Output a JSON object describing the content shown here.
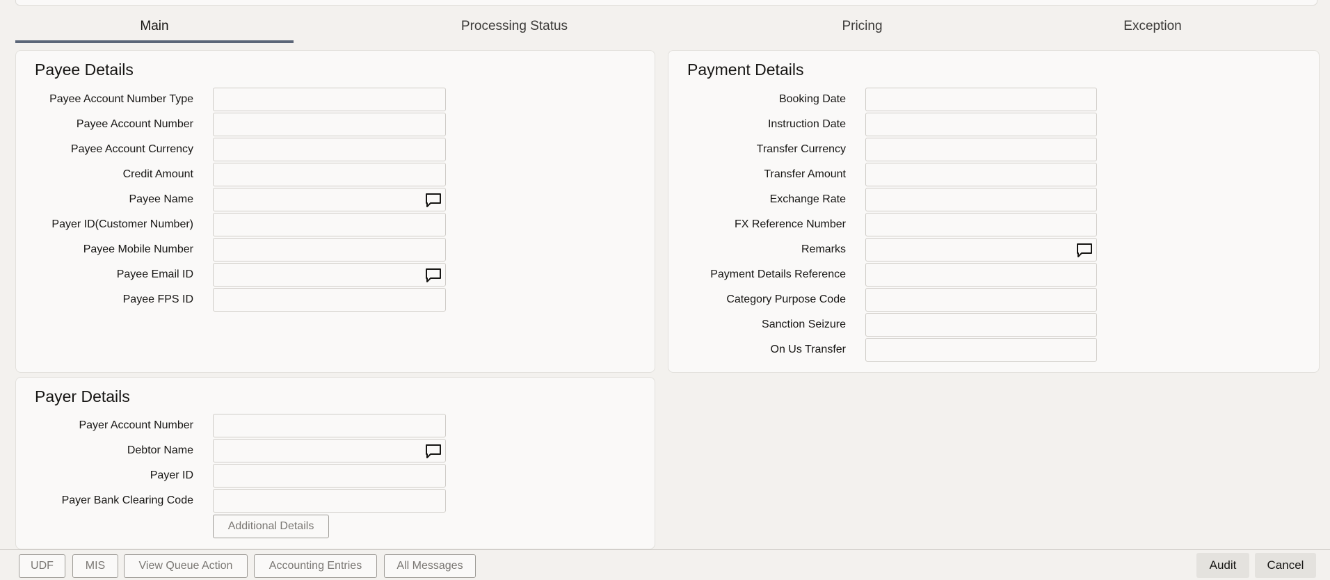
{
  "tabs": [
    {
      "label": "Main",
      "active": true
    },
    {
      "label": "Processing Status",
      "active": false
    },
    {
      "label": "Pricing",
      "active": false
    },
    {
      "label": "Exception",
      "active": false
    }
  ],
  "payee_details": {
    "title": "Payee Details",
    "fields": [
      {
        "label": "Payee Account Number Type",
        "value": "",
        "has_icon": false
      },
      {
        "label": "Payee Account Number",
        "value": "",
        "has_icon": false
      },
      {
        "label": "Payee Account Currency",
        "value": "",
        "has_icon": false
      },
      {
        "label": "Credit Amount",
        "value": "",
        "has_icon": false
      },
      {
        "label": "Payee Name",
        "value": "",
        "has_icon": true
      },
      {
        "label": "Payer ID(Customer Number)",
        "value": "",
        "has_icon": false
      },
      {
        "label": "Payee Mobile Number",
        "value": "",
        "has_icon": false
      },
      {
        "label": "Payee Email ID",
        "value": "",
        "has_icon": true
      },
      {
        "label": "Payee FPS ID",
        "value": "",
        "has_icon": false
      }
    ]
  },
  "payment_details": {
    "title": "Payment Details",
    "fields": [
      {
        "label": "Booking Date",
        "value": "",
        "has_icon": false
      },
      {
        "label": "Instruction Date",
        "value": "",
        "has_icon": false
      },
      {
        "label": "Transfer Currency",
        "value": "",
        "has_icon": false
      },
      {
        "label": "Transfer Amount",
        "value": "",
        "has_icon": false
      },
      {
        "label": "Exchange Rate",
        "value": "",
        "has_icon": false
      },
      {
        "label": "FX Reference Number",
        "value": "",
        "has_icon": false
      },
      {
        "label": "Remarks",
        "value": "",
        "has_icon": true
      },
      {
        "label": "Payment Details Reference",
        "value": "",
        "has_icon": false
      },
      {
        "label": "Category Purpose Code",
        "value": "",
        "has_icon": false
      },
      {
        "label": "Sanction Seizure",
        "value": "",
        "has_icon": false
      },
      {
        "label": "On Us Transfer",
        "value": "",
        "has_icon": false
      }
    ]
  },
  "payer_details": {
    "title": "Payer Details",
    "fields": [
      {
        "label": "Payer Account Number",
        "value": "",
        "has_icon": false
      },
      {
        "label": "Debtor Name",
        "value": "",
        "has_icon": true
      },
      {
        "label": "Payer ID",
        "value": "",
        "has_icon": false
      },
      {
        "label": "Payer Bank Clearing Code",
        "value": "",
        "has_icon": false
      }
    ],
    "additional_details_label": "Additional Details"
  },
  "footer": {
    "left_buttons": [
      "UDF",
      "MIS",
      "View Queue Action",
      "Accounting Entries",
      "All Messages"
    ],
    "audit_label": "Audit",
    "cancel_label": "Cancel"
  },
  "icons": {
    "field_icon": "chat-bubble-icon"
  },
  "colors": {
    "active_tab_underline": "#5b6678",
    "background": "#f3f1ee",
    "panel": "#faf9f8"
  }
}
